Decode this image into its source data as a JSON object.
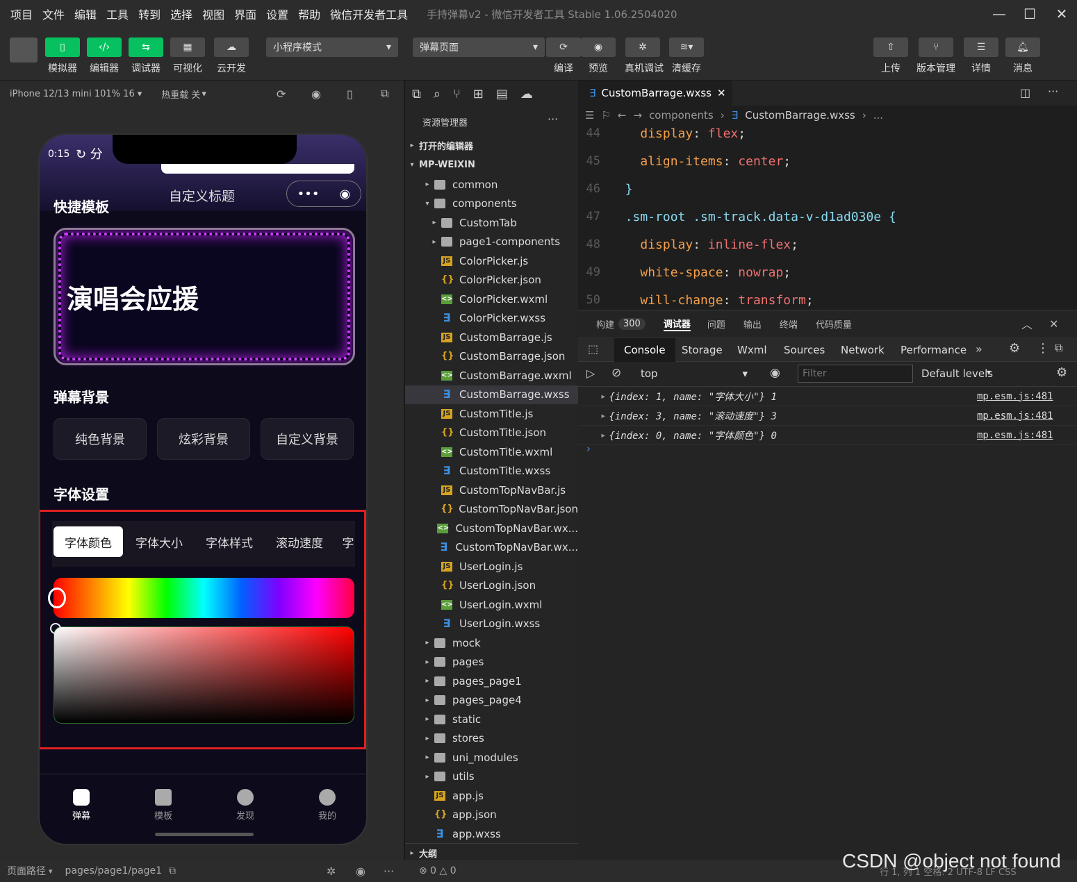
{
  "menubar": {
    "items": [
      "项目",
      "文件",
      "编辑",
      "工具",
      "转到",
      "选择",
      "视图",
      "界面",
      "设置",
      "帮助",
      "微信开发者工具"
    ],
    "window_title": "手持弹幕v2 - 微信开发者工具 Stable 1.06.2504020"
  },
  "toolbar": {
    "left_buttons": [
      "模拟器",
      "编辑器",
      "调试器",
      "可视化",
      "云开发"
    ],
    "mode_select": "小程序模式",
    "page_select": "弹幕页面",
    "mid_buttons": [
      "编译",
      "预览",
      "真机调试",
      "清缓存"
    ],
    "right_buttons": [
      "上传",
      "版本管理",
      "详情",
      "消息"
    ]
  },
  "simulator": {
    "device": "iPhone 12/13 mini 101% 16",
    "hot_reload": "热重载 关",
    "phone": {
      "time": "0:15",
      "title": "自定义标题",
      "sections": {
        "quick": "快捷模板",
        "card_text": "演唱会应援",
        "bg": "弹幕背景",
        "font": "字体设置"
      },
      "bg_buttons": [
        "纯色背景",
        "炫彩背景",
        "自定义背景"
      ],
      "font_tabs": [
        "字体颜色",
        "字体大小",
        "字体样式",
        "滚动速度",
        "字"
      ],
      "tabbar": [
        "弹幕",
        "模板",
        "发现",
        "我的"
      ]
    }
  },
  "explorer": {
    "title": "资源管理器",
    "open_editors": "打开的编辑器",
    "root": "MP-WEIXIN",
    "outline": "大纲",
    "tree": [
      {
        "name": "common",
        "type": "folder",
        "depth": 1,
        "caret": "▸"
      },
      {
        "name": "components",
        "type": "folder",
        "depth": 1,
        "caret": "▾"
      },
      {
        "name": "CustomTab",
        "type": "folder",
        "depth": 2,
        "caret": "▸"
      },
      {
        "name": "page1-components",
        "type": "folder",
        "depth": 2,
        "caret": "▸"
      },
      {
        "name": "ColorPicker.js",
        "type": "js",
        "depth": 2
      },
      {
        "name": "ColorPicker.json",
        "type": "json",
        "depth": 2
      },
      {
        "name": "ColorPicker.wxml",
        "type": "wxml",
        "depth": 2
      },
      {
        "name": "ColorPicker.wxss",
        "type": "wxss",
        "depth": 2
      },
      {
        "name": "CustomBarrage.js",
        "type": "js",
        "depth": 2
      },
      {
        "name": "CustomBarrage.json",
        "type": "json",
        "depth": 2
      },
      {
        "name": "CustomBarrage.wxml",
        "type": "wxml",
        "depth": 2
      },
      {
        "name": "CustomBarrage.wxss",
        "type": "wxss",
        "depth": 2,
        "selected": true
      },
      {
        "name": "CustomTitle.js",
        "type": "js",
        "depth": 2
      },
      {
        "name": "CustomTitle.json",
        "type": "json",
        "depth": 2
      },
      {
        "name": "CustomTitle.wxml",
        "type": "wxml",
        "depth": 2
      },
      {
        "name": "CustomTitle.wxss",
        "type": "wxss",
        "depth": 2
      },
      {
        "name": "CustomTopNavBar.js",
        "type": "js",
        "depth": 2
      },
      {
        "name": "CustomTopNavBar.json",
        "type": "json",
        "depth": 2
      },
      {
        "name": "CustomTopNavBar.wx...",
        "type": "wxml",
        "depth": 2
      },
      {
        "name": "CustomTopNavBar.wx...",
        "type": "wxss",
        "depth": 2
      },
      {
        "name": "UserLogin.js",
        "type": "js",
        "depth": 2
      },
      {
        "name": "UserLogin.json",
        "type": "json",
        "depth": 2
      },
      {
        "name": "UserLogin.wxml",
        "type": "wxml",
        "depth": 2
      },
      {
        "name": "UserLogin.wxss",
        "type": "wxss",
        "depth": 2
      },
      {
        "name": "mock",
        "type": "folder",
        "depth": 1,
        "caret": "▸"
      },
      {
        "name": "pages",
        "type": "folder",
        "depth": 1,
        "caret": "▸"
      },
      {
        "name": "pages_page1",
        "type": "folder",
        "depth": 1,
        "caret": "▸"
      },
      {
        "name": "pages_page4",
        "type": "folder",
        "depth": 1,
        "caret": "▸"
      },
      {
        "name": "static",
        "type": "folder",
        "depth": 1,
        "caret": "▸"
      },
      {
        "name": "stores",
        "type": "folder",
        "depth": 1,
        "caret": "▸"
      },
      {
        "name": "uni_modules",
        "type": "folder",
        "depth": 1,
        "caret": "▸"
      },
      {
        "name": "utils",
        "type": "folder",
        "depth": 1,
        "caret": "▸"
      },
      {
        "name": "app.js",
        "type": "js",
        "depth": 1
      },
      {
        "name": "app.json",
        "type": "json",
        "depth": 1
      },
      {
        "name": "app.wxss",
        "type": "wxss",
        "depth": 1
      }
    ]
  },
  "editor": {
    "tab": "CustomBarrage.wxss",
    "breadcrumb": [
      "components",
      "CustomBarrage.wxss",
      "..."
    ],
    "lines": [
      {
        "n": "44",
        "code": "    display: flex;"
      },
      {
        "n": "45",
        "code": "    align-items: center;"
      },
      {
        "n": "46",
        "code": "  }"
      },
      {
        "n": "47",
        "code": "  .sm-root .sm-track.data-v-d1ad030e {"
      },
      {
        "n": "48",
        "code": "    display: inline-flex;"
      },
      {
        "n": "49",
        "code": "    white-space: nowrap;"
      },
      {
        "n": "50",
        "code": "    will-change: transform;"
      }
    ]
  },
  "devtools": {
    "top_tabs": [
      "构建",
      "300",
      "调试器",
      "问题",
      "输出",
      "终端",
      "代码质量"
    ],
    "tabs": [
      "Console",
      "Storage",
      "Wxml",
      "Sources",
      "Network",
      "Performance"
    ],
    "context": "top",
    "filter_placeholder": "Filter",
    "levels": "Default levels",
    "logs": [
      {
        "text": "{index: 1, name: \"字体大小\"} 1",
        "src": "mp.esm.js:481"
      },
      {
        "text": "{index: 3, name: \"滚动速度\"} 3",
        "src": "mp.esm.js:481"
      },
      {
        "text": "{index: 0, name: \"字体颜色\"} 0",
        "src": "mp.esm.js:481"
      }
    ]
  },
  "statusbar": {
    "path_label": "页面路径",
    "path": "pages/page1/page1",
    "errors": "⊗ 0 △ 0",
    "right": "行 1, 列 1   空格: 2   UTF-8   LF   CSS",
    "watermark": "CSDN @object not found"
  },
  "colors": {
    "accent_green": "#07c160",
    "highlight_red": "#e02020",
    "neon_purple": "#d040ff"
  }
}
